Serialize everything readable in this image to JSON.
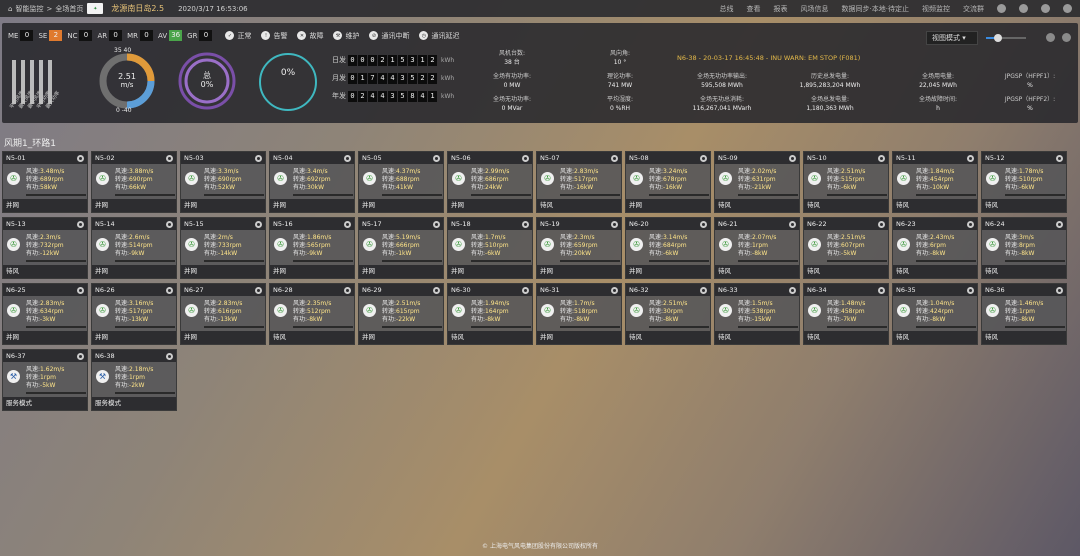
{
  "topbar": {
    "breadcrumb": [
      "智能监控",
      "全场首页"
    ],
    "farm_name": "龙源南日岛2.5",
    "datetime": "2020/3/17 16:53:06",
    "nav": [
      "总线",
      "查看",
      "报表",
      "风场信息",
      "数据同步·本地·待定止",
      "视频监控",
      "交流群"
    ]
  },
  "status": {
    "items": [
      {
        "code": "ME",
        "count": "0",
        "color": "#111111"
      },
      {
        "code": "SE",
        "count": "2",
        "color": "#e07a2e"
      },
      {
        "code": "NC",
        "count": "0",
        "color": "#111111"
      },
      {
        "code": "AR",
        "count": "0",
        "color": "#111111"
      },
      {
        "code": "MR",
        "count": "0",
        "color": "#111111"
      },
      {
        "code": "AV",
        "count": "36",
        "color": "#4aa44a"
      },
      {
        "code": "GR",
        "count": "0",
        "color": "#111111"
      }
    ],
    "legend": [
      "正常",
      "告警",
      "故障",
      "维护",
      "通讯中断",
      "通讯延迟"
    ]
  },
  "view_mode": "视图模式 ▾",
  "volume_level": 0.3,
  "mini_bars": [
    "平均风速",
    "最大风速",
    "最小风速",
    "平均功率",
    "最大功率"
  ],
  "wind_gauge": {
    "top": "35 40",
    "value": "2.51",
    "unit": "m/s",
    "bottom": "0 -40"
  },
  "total_gauge": {
    "label": "总",
    "value": "0%"
  },
  "pct_gauge": {
    "value": "0%"
  },
  "counters": [
    {
      "label": "日发",
      "digits": [
        "0",
        "0",
        "0",
        "2",
        "1",
        "5",
        "3",
        "1",
        "2"
      ],
      "unit": "kWh"
    },
    {
      "label": "月发",
      "digits": [
        "0",
        "1",
        "7",
        "4",
        "4",
        "3",
        "5",
        "2",
        "2"
      ],
      "unit": "kWh"
    },
    {
      "label": "年发",
      "digits": [
        "0",
        "2",
        "4",
        "4",
        "3",
        "5",
        "8",
        "4",
        "1"
      ],
      "unit": "kWh"
    }
  ],
  "stats": [
    {
      "label": "风机台数:",
      "value": "38 台"
    },
    {
      "label": "风向角:",
      "value": "10 °"
    },
    {
      "label": "全场有功功率:",
      "value": "0 MW"
    },
    {
      "label": "理论功率:",
      "value": "741 MW"
    },
    {
      "label": "全场无功功率输出:",
      "value": "595,508 MWh"
    },
    {
      "label": "历史总发电量:",
      "value": "1,895,283,204 MWh"
    },
    {
      "label": "全场用电量:",
      "value": "22,045 MWh"
    },
    {
      "label": "JPGSP（HFPF1）:",
      "value": "%"
    },
    {
      "label": "全场无功功率:",
      "value": "0 MVar"
    },
    {
      "label": "平均湿度:",
      "value": "0 %RH"
    },
    {
      "label": "全场无功总消耗:",
      "value": "116,267,041 MVarh"
    },
    {
      "label": "全场总发电量:",
      "value": "1,180,363 MWh"
    },
    {
      "label": "全场故障时间:",
      "value": "h"
    },
    {
      "label": "JPGSP（HFPF2）:",
      "value": "%"
    }
  ],
  "alarm_text": "N6-38 - 20-03-17 16:45:48 - INU WARN: EM STOP (F081)",
  "section_title": "风期1_环路1",
  "labels": {
    "ws": "风速:",
    "rpm": "转速:",
    "pw": "有功:"
  },
  "turbines": [
    {
      "id": "N5-01",
      "ws": "3.48m/s",
      "rpm": "689rpm",
      "pw": "58kW",
      "state": "并网",
      "icon": "fan"
    },
    {
      "id": "N5-02",
      "ws": "3.88m/s",
      "rpm": "690rpm",
      "pw": "66kW",
      "state": "并网",
      "icon": "fan"
    },
    {
      "id": "N5-03",
      "ws": "3.3m/s",
      "rpm": "690rpm",
      "pw": "52kW",
      "state": "并网",
      "icon": "fan"
    },
    {
      "id": "N5-04",
      "ws": "3.4m/s",
      "rpm": "692rpm",
      "pw": "30kW",
      "state": "并网",
      "icon": "fan"
    },
    {
      "id": "N5-05",
      "ws": "4.37m/s",
      "rpm": "688rpm",
      "pw": "41kW",
      "state": "并网",
      "icon": "fan"
    },
    {
      "id": "N5-06",
      "ws": "2.99m/s",
      "rpm": "686rpm",
      "pw": "24kW",
      "state": "并网",
      "icon": "fan"
    },
    {
      "id": "N5-07",
      "ws": "2.83m/s",
      "rpm": "517rpm",
      "pw": "-16kW",
      "state": "待风",
      "icon": "fan"
    },
    {
      "id": "N5-08",
      "ws": "3.24m/s",
      "rpm": "678rpm",
      "pw": "-16kW",
      "state": "并网",
      "icon": "fan"
    },
    {
      "id": "N5-09",
      "ws": "2.02m/s",
      "rpm": "631rpm",
      "pw": "-21kW",
      "state": "待风",
      "icon": "fan"
    },
    {
      "id": "N5-10",
      "ws": "2.51m/s",
      "rpm": "515rpm",
      "pw": "-6kW",
      "state": "待风",
      "icon": "fan"
    },
    {
      "id": "N5-11",
      "ws": "1.84m/s",
      "rpm": "454rpm",
      "pw": "-10kW",
      "state": "待风",
      "icon": "fan"
    },
    {
      "id": "N5-12",
      "ws": "1.78m/s",
      "rpm": "510rpm",
      "pw": "-6kW",
      "state": "待风",
      "icon": "fan"
    },
    {
      "id": "N5-13",
      "ws": "2.3m/s",
      "rpm": "732rpm",
      "pw": "-12kW",
      "state": "待风",
      "icon": "fan"
    },
    {
      "id": "N5-14",
      "ws": "2.6m/s",
      "rpm": "514rpm",
      "pw": "-9kW",
      "state": "并网",
      "icon": "fan"
    },
    {
      "id": "N5-15",
      "ws": "2m/s",
      "rpm": "733rpm",
      "pw": "-14kW",
      "state": "并网",
      "icon": "fan"
    },
    {
      "id": "N5-16",
      "ws": "1.86m/s",
      "rpm": "565rpm",
      "pw": "-9kW",
      "state": "并网",
      "icon": "fan"
    },
    {
      "id": "N5-17",
      "ws": "5.19m/s",
      "rpm": "666rpm",
      "pw": "-1kW",
      "state": "并网",
      "icon": "fan"
    },
    {
      "id": "N5-18",
      "ws": "1.7m/s",
      "rpm": "510rpm",
      "pw": "-6kW",
      "state": "并网",
      "icon": "fan"
    },
    {
      "id": "N5-19",
      "ws": "2.3m/s",
      "rpm": "659rpm",
      "pw": "20kW",
      "state": "并网",
      "icon": "fan"
    },
    {
      "id": "N6-20",
      "ws": "3.14m/s",
      "rpm": "684rpm",
      "pw": "-6kW",
      "state": "并网",
      "icon": "fan"
    },
    {
      "id": "N6-21",
      "ws": "2.07m/s",
      "rpm": "1rpm",
      "pw": "-8kW",
      "state": "待风",
      "icon": "fan"
    },
    {
      "id": "N6-22",
      "ws": "2.51m/s",
      "rpm": "607rpm",
      "pw": "-5kW",
      "state": "待风",
      "icon": "fan"
    },
    {
      "id": "N6-23",
      "ws": "2.43m/s",
      "rpm": "6rpm",
      "pw": "-8kW",
      "state": "待风",
      "icon": "fan"
    },
    {
      "id": "N6-24",
      "ws": "3m/s",
      "rpm": "8rpm",
      "pw": "-8kW",
      "state": "待风",
      "icon": "fan"
    },
    {
      "id": "N6-25",
      "ws": "2.83m/s",
      "rpm": "634rpm",
      "pw": "-3kW",
      "state": "并网",
      "icon": "fan"
    },
    {
      "id": "N6-26",
      "ws": "3.16m/s",
      "rpm": "517rpm",
      "pw": "-13kW",
      "state": "并网",
      "icon": "fan"
    },
    {
      "id": "N6-27",
      "ws": "2.83m/s",
      "rpm": "616rpm",
      "pw": "-13kW",
      "state": "并网",
      "icon": "fan"
    },
    {
      "id": "N6-28",
      "ws": "2.35m/s",
      "rpm": "512rpm",
      "pw": "-8kW",
      "state": "待风",
      "icon": "fan"
    },
    {
      "id": "N6-29",
      "ws": "2.51m/s",
      "rpm": "615rpm",
      "pw": "-22kW",
      "state": "并网",
      "icon": "fan"
    },
    {
      "id": "N6-30",
      "ws": "1.94m/s",
      "rpm": "164rpm",
      "pw": "-8kW",
      "state": "待风",
      "icon": "fan"
    },
    {
      "id": "N6-31",
      "ws": "1.7m/s",
      "rpm": "518rpm",
      "pw": "-8kW",
      "state": "并网",
      "icon": "fan"
    },
    {
      "id": "N6-32",
      "ws": "2.51m/s",
      "rpm": "30rpm",
      "pw": "-8kW",
      "state": "待风",
      "icon": "fan"
    },
    {
      "id": "N6-33",
      "ws": "1.5m/s",
      "rpm": "538rpm",
      "pw": "-15kW",
      "state": "待风",
      "icon": "fan"
    },
    {
      "id": "N6-34",
      "ws": "1.48m/s",
      "rpm": "458rpm",
      "pw": "-7kW",
      "state": "待风",
      "icon": "fan"
    },
    {
      "id": "N6-35",
      "ws": "1.04m/s",
      "rpm": "424rpm",
      "pw": "-8kW",
      "state": "待风",
      "icon": "fan"
    },
    {
      "id": "N6-36",
      "ws": "1.46m/s",
      "rpm": "1rpm",
      "pw": "-8kW",
      "state": "待风",
      "icon": "fan"
    },
    {
      "id": "N6-37",
      "ws": "1.62m/s",
      "rpm": "1rpm",
      "pw": "-5kW",
      "state": "服务模式",
      "icon": "wrench"
    },
    {
      "id": "N6-38",
      "ws": "2.18m/s",
      "rpm": "1rpm",
      "pw": "-2kW",
      "state": "服务模式",
      "icon": "wrench"
    }
  ],
  "footer": "© 上海电气风电集团股份有限公司版权所有"
}
